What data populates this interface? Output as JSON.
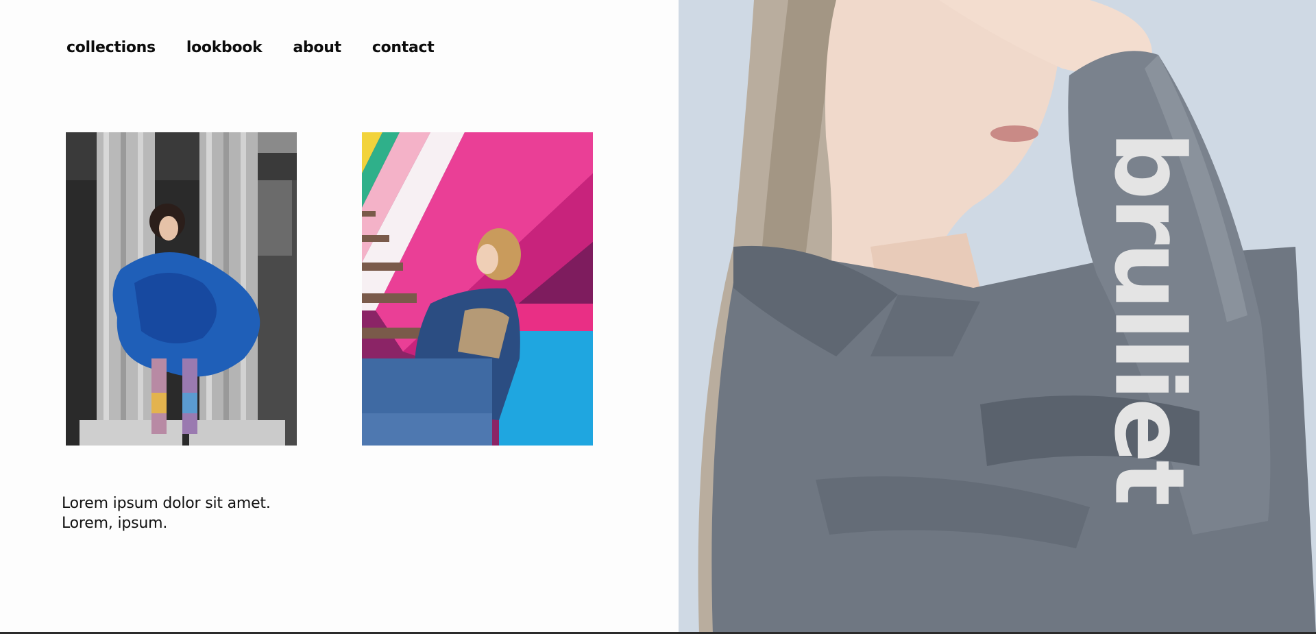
{
  "nav": {
    "items": [
      {
        "label": "collections"
      },
      {
        "label": "lookbook"
      },
      {
        "label": "about"
      },
      {
        "label": "contact"
      }
    ]
  },
  "caption": {
    "line1": "Lorem ipsum dolor sit amet.",
    "line2": "Lorem, ipsum."
  },
  "hero": {
    "brand": "brulliet"
  },
  "colors": {
    "background": "#fdfdfd",
    "text": "#0c0c0c",
    "hero_bg": "#cfd9e4",
    "brand_text": "#e4e4e4",
    "tulle_blue": "#1f5fb8",
    "shirt_gray": "#6f7782"
  }
}
